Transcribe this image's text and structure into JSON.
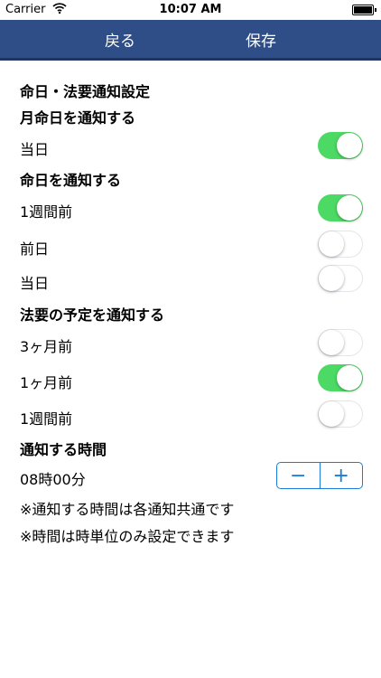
{
  "status_bar": {
    "carrier": "Carrier",
    "time": "10:07 AM"
  },
  "nav": {
    "back_label": "戻る",
    "save_label": "保存"
  },
  "title": "命日・法要通知設定",
  "sections": [
    {
      "header": "月命日を通知する",
      "items": [
        {
          "label": "当日",
          "on": true
        }
      ]
    },
    {
      "header": "命日を通知する",
      "items": [
        {
          "label": "1週間前",
          "on": true
        },
        {
          "label": "前日",
          "on": false
        },
        {
          "label": "当日",
          "on": false
        }
      ]
    },
    {
      "header": "法要の予定を通知する",
      "items": [
        {
          "label": "3ヶ月前",
          "on": false
        },
        {
          "label": "1ヶ月前",
          "on": true
        },
        {
          "label": "1週間前",
          "on": false
        }
      ]
    }
  ],
  "time_section": {
    "header": "通知する時間",
    "value": "08時00分",
    "minus": "−",
    "plus": "+",
    "notes": [
      "※通知する時間は各通知共通です",
      "※時間は時単位のみ設定できます"
    ]
  },
  "colors": {
    "nav": "#2f4d86",
    "toggle_on": "#4cd964",
    "stepper": "#1a7cd6"
  }
}
